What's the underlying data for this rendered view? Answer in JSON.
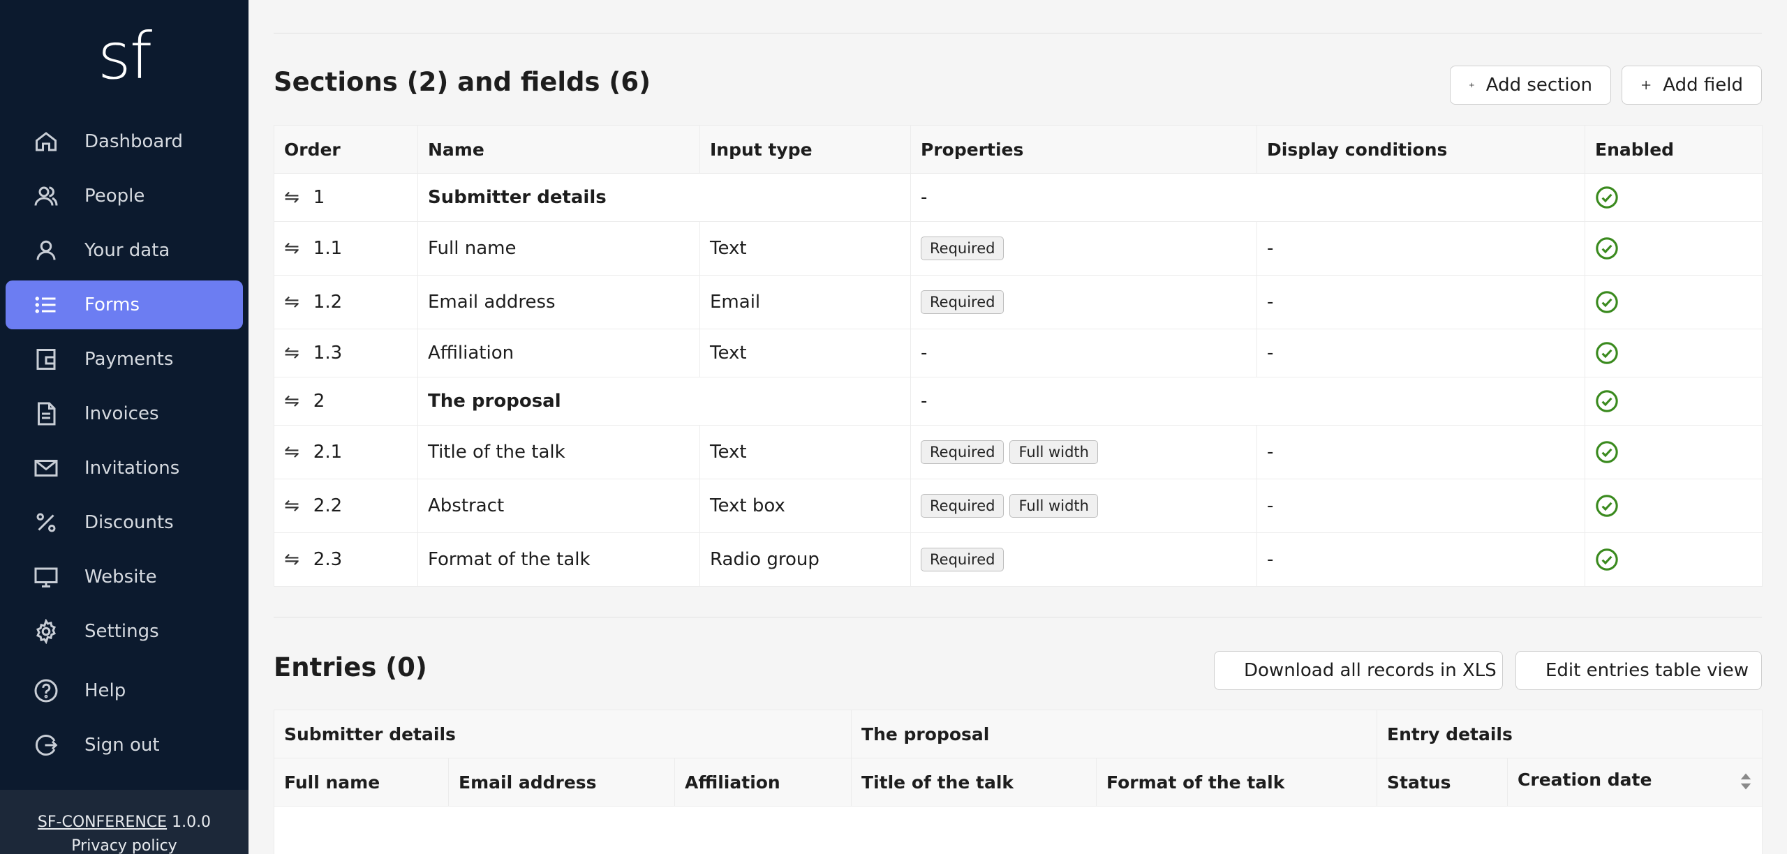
{
  "sidebar": {
    "logo": "sf",
    "items": [
      {
        "label": "Dashboard",
        "icon": "home-icon"
      },
      {
        "label": "People",
        "icon": "people-icon"
      },
      {
        "label": "Your data",
        "icon": "user-icon"
      },
      {
        "label": "Forms",
        "icon": "list-icon",
        "active": true
      },
      {
        "label": "Payments",
        "icon": "wallet-icon"
      },
      {
        "label": "Invoices",
        "icon": "document-icon"
      },
      {
        "label": "Invitations",
        "icon": "envelope-icon"
      },
      {
        "label": "Discounts",
        "icon": "percent-icon"
      },
      {
        "label": "Website",
        "icon": "monitor-icon"
      },
      {
        "label": "Settings",
        "icon": "gear-icon"
      },
      {
        "label": "Help",
        "icon": "help-icon"
      },
      {
        "label": "Sign out",
        "icon": "sign-out-icon"
      }
    ],
    "footer": {
      "app_name": "SF-CONFERENCE",
      "version": "1.0.0",
      "privacy": "Privacy policy"
    }
  },
  "sections": {
    "title": "Sections (2) and fields (6)",
    "add_section": "Add section",
    "add_field": "Add field",
    "headers": [
      "Order",
      "Name",
      "Input type",
      "Properties",
      "Display conditions",
      "Enabled"
    ],
    "rows": [
      {
        "kind": "section",
        "order": "1",
        "name": "Submitter details",
        "properties": "-"
      },
      {
        "kind": "field",
        "order": "1.1",
        "name": "Full name",
        "input_type": "Text",
        "tags": [
          "Required"
        ],
        "conditions": "-"
      },
      {
        "kind": "field",
        "order": "1.2",
        "name": "Email address",
        "input_type": "Email",
        "tags": [
          "Required"
        ],
        "conditions": "-"
      },
      {
        "kind": "field",
        "order": "1.3",
        "name": "Affiliation",
        "input_type": "Text",
        "properties": "-",
        "conditions": "-"
      },
      {
        "kind": "section",
        "order": "2",
        "name": "The proposal",
        "properties": "-"
      },
      {
        "kind": "field",
        "order": "2.1",
        "name": "Title of the talk",
        "input_type": "Text",
        "tags": [
          "Required",
          "Full width"
        ],
        "conditions": "-"
      },
      {
        "kind": "field",
        "order": "2.2",
        "name": "Abstract",
        "input_type": "Text box",
        "tags": [
          "Required",
          "Full width"
        ],
        "conditions": "-"
      },
      {
        "kind": "field",
        "order": "2.3",
        "name": "Format of the talk",
        "input_type": "Radio group",
        "tags": [
          "Required"
        ],
        "conditions": "-"
      }
    ]
  },
  "entries": {
    "title": "Entries (0)",
    "download": "Download all records in XLS",
    "edit_view": "Edit entries table view",
    "groups": [
      "Submitter details",
      "The proposal",
      "Entry details"
    ],
    "columns": [
      "Full name",
      "Email address",
      "Affiliation",
      "Title of the talk",
      "Format of the talk",
      "Status",
      "Creation date"
    ]
  },
  "colors": {
    "sidebar_bg": "#0c1a2e",
    "accent": "#6c7df2",
    "enabled_check": "#3a8a1e"
  }
}
